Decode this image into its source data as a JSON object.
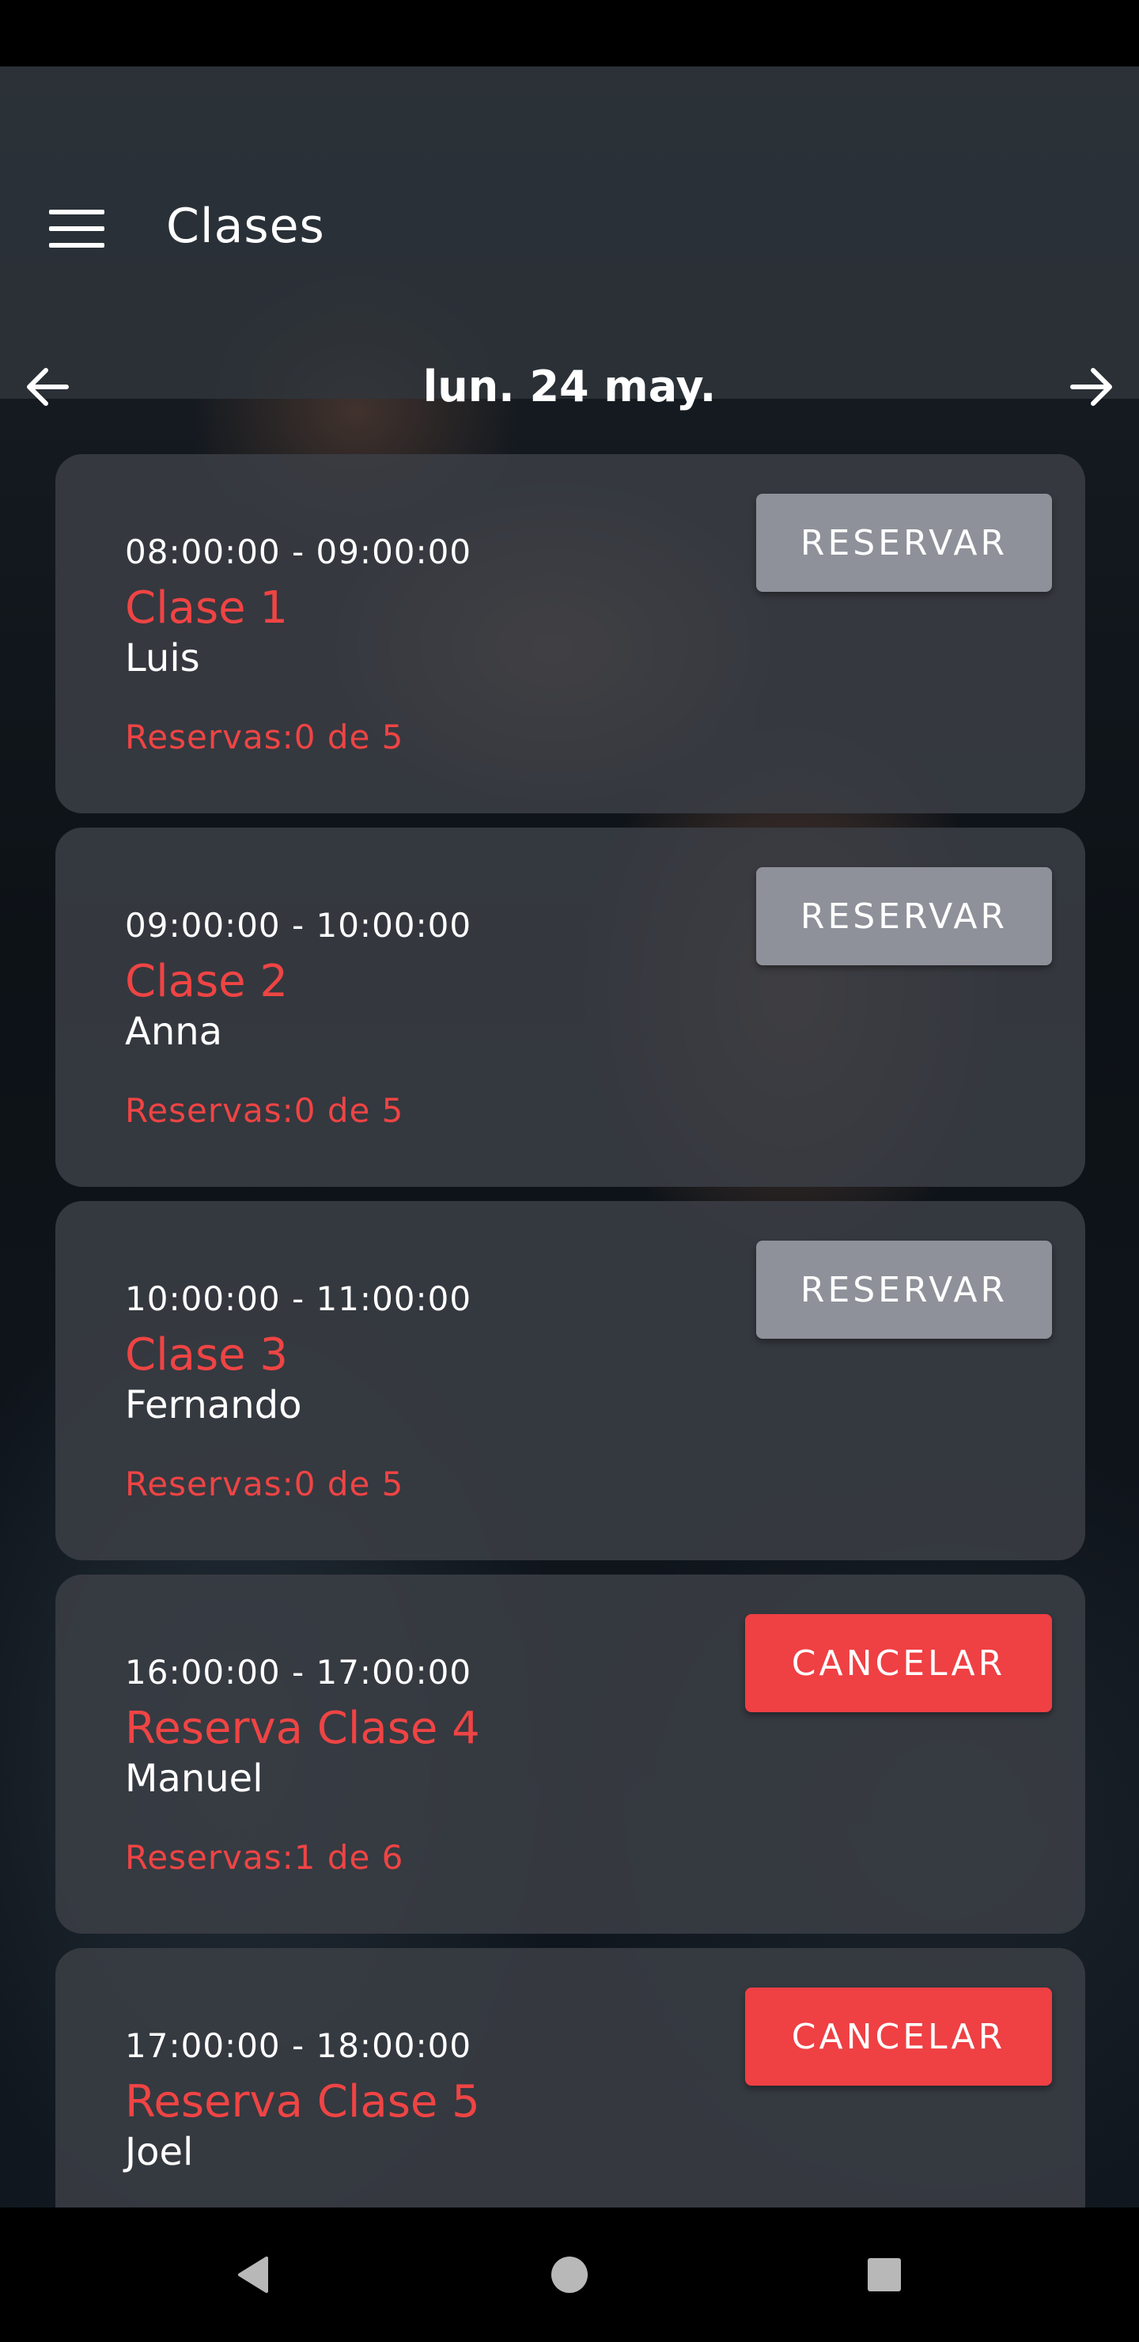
{
  "app_bar": {
    "title": "Clases",
    "date": "lun. 24 may."
  },
  "classes": [
    {
      "time": "08:00:00 - 09:00:00",
      "name": "Clase 1",
      "teacher": "Luis",
      "bookings": "Reservas:0 de 5",
      "action": "RESERVAR"
    },
    {
      "time": "09:00:00 - 10:00:00",
      "name": "Clase 2",
      "teacher": "Anna",
      "bookings": "Reservas:0 de 5",
      "action": "RESERVAR"
    },
    {
      "time": "10:00:00 - 11:00:00",
      "name": "Clase 3",
      "teacher": "Fernando",
      "bookings": "Reservas:0 de 5",
      "action": "RESERVAR"
    },
    {
      "time": "16:00:00 - 17:00:00",
      "name": "Reserva Clase 4",
      "teacher": "Manuel",
      "bookings": "Reservas:1 de 6",
      "action": "CANCELAR"
    },
    {
      "time": "17:00:00 - 18:00:00",
      "name": "Reserva Clase 5",
      "teacher": "Joel",
      "bookings": "",
      "action": "CANCELAR"
    }
  ],
  "icons": {
    "menu": "menu-icon",
    "previous": "arrow-left-icon",
    "next": "arrow-right-icon",
    "nav_back": "triangle-back-icon",
    "nav_home": "circle-home-icon",
    "nav_recent": "square-recent-icon"
  },
  "colors": {
    "accent_red": "#ef4444",
    "reserve_button": "#8e9199",
    "cancel_button": "#ef4044",
    "card_background": "#3a3e44",
    "app_bar_background": "#30363c"
  }
}
